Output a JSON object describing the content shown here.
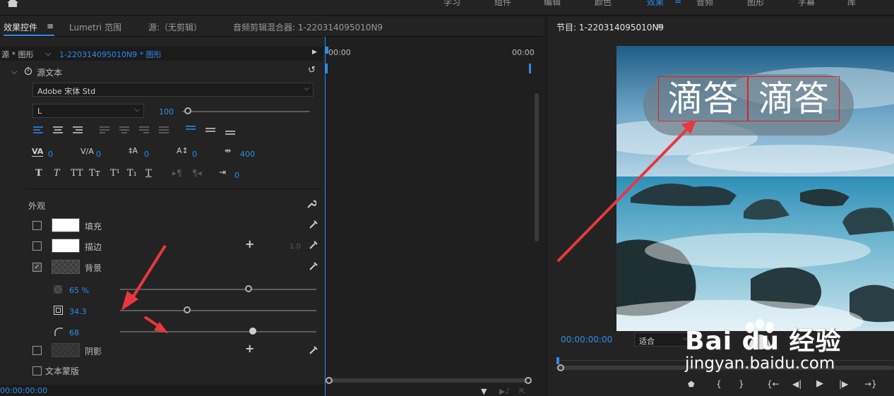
{
  "top_bar": {
    "workspaces": [
      "学习",
      "组件",
      "编辑",
      "颜色",
      "效果",
      "音频",
      "图形",
      "字幕",
      "库"
    ],
    "active_workspace": "效果"
  },
  "panel_tabs": {
    "effect_controls": "效果控件",
    "lumetri": "Lumetri 范围",
    "source": "源:（无剪辑）",
    "audio_mixer": "音频剪辑混合器: 1-220314095010N9"
  },
  "clip_bar": {
    "source_label": "源 * 图形",
    "sequence_label": "1-220314095010N9 * 图形"
  },
  "source_text": {
    "section_label": "源文本",
    "font_family": "Adobe 宋体 Std",
    "font_style": "L",
    "font_size": "100",
    "tracking_values": {
      "kerning": "0",
      "tracking": "0",
      "leading": "0",
      "baseline": "0",
      "tsume": "400",
      "tab_width": "0"
    }
  },
  "appearance": {
    "section_label": "外观",
    "fill_label": "填充",
    "stroke_label": "描边",
    "stroke_width": "1.0",
    "background_label": "背景",
    "background_checked": true,
    "opacity_value": "65 %",
    "size_value": "34.3",
    "corner_value": "68",
    "shadow_label": "阴影",
    "text_mask_label": "文本蒙版"
  },
  "timeline": {
    "start_time": "00:00",
    "end_time": "00:00"
  },
  "status_bar": {
    "timecode": "00:00:00:00"
  },
  "program_monitor": {
    "title": "节目: 1-220314095010N9",
    "overlay_text_1": "滴答",
    "overlay_text_2": "滴答",
    "timecode": "00:00:00:00",
    "fit_label": "适合"
  },
  "watermark": {
    "brand": "Bai du 经验",
    "url": "jingyan.baidu.com"
  },
  "colors": {
    "accent": "#2d8ceb",
    "panel_bg": "#232323",
    "annotation_red": "#e8383d"
  }
}
